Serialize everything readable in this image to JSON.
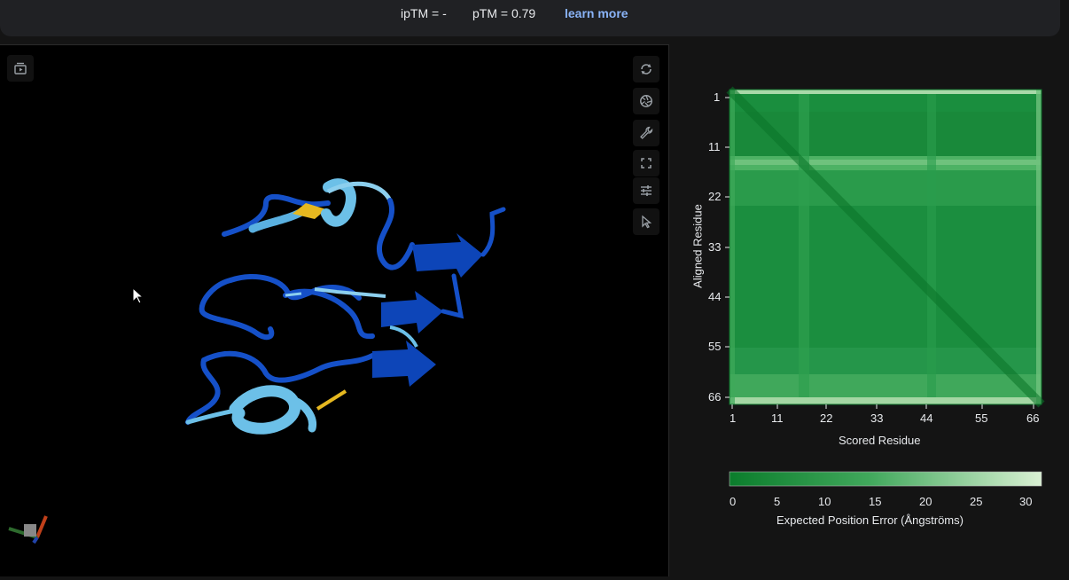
{
  "header": {
    "iptm": "ipTM = -",
    "ptm": "pTM = 0.79",
    "learn_more": "learn more"
  },
  "viewer": {
    "toolbar": [
      {
        "name": "rotate-icon"
      },
      {
        "name": "camera-shutter-icon"
      },
      {
        "name": "wrench-icon"
      },
      {
        "name": "fullscreen-icon"
      },
      {
        "name": "sliders-icon"
      },
      {
        "name": "pointer-icon"
      }
    ],
    "left_button": "media-play-icon"
  },
  "pae": {
    "y_axis_label": "Aligned Residue",
    "x_axis_label": "Scored Residue",
    "ticks": [
      "1",
      "11",
      "22",
      "33",
      "44",
      "55",
      "66"
    ],
    "colorbar_ticks": [
      "0",
      "5",
      "10",
      "15",
      "20",
      "25",
      "30"
    ],
    "colorbar_label": "Expected Position Error (Ångströms)",
    "colors": {
      "low": "#0b7d2c",
      "mid": "#41a85c",
      "high": "#d9f0d3"
    }
  }
}
